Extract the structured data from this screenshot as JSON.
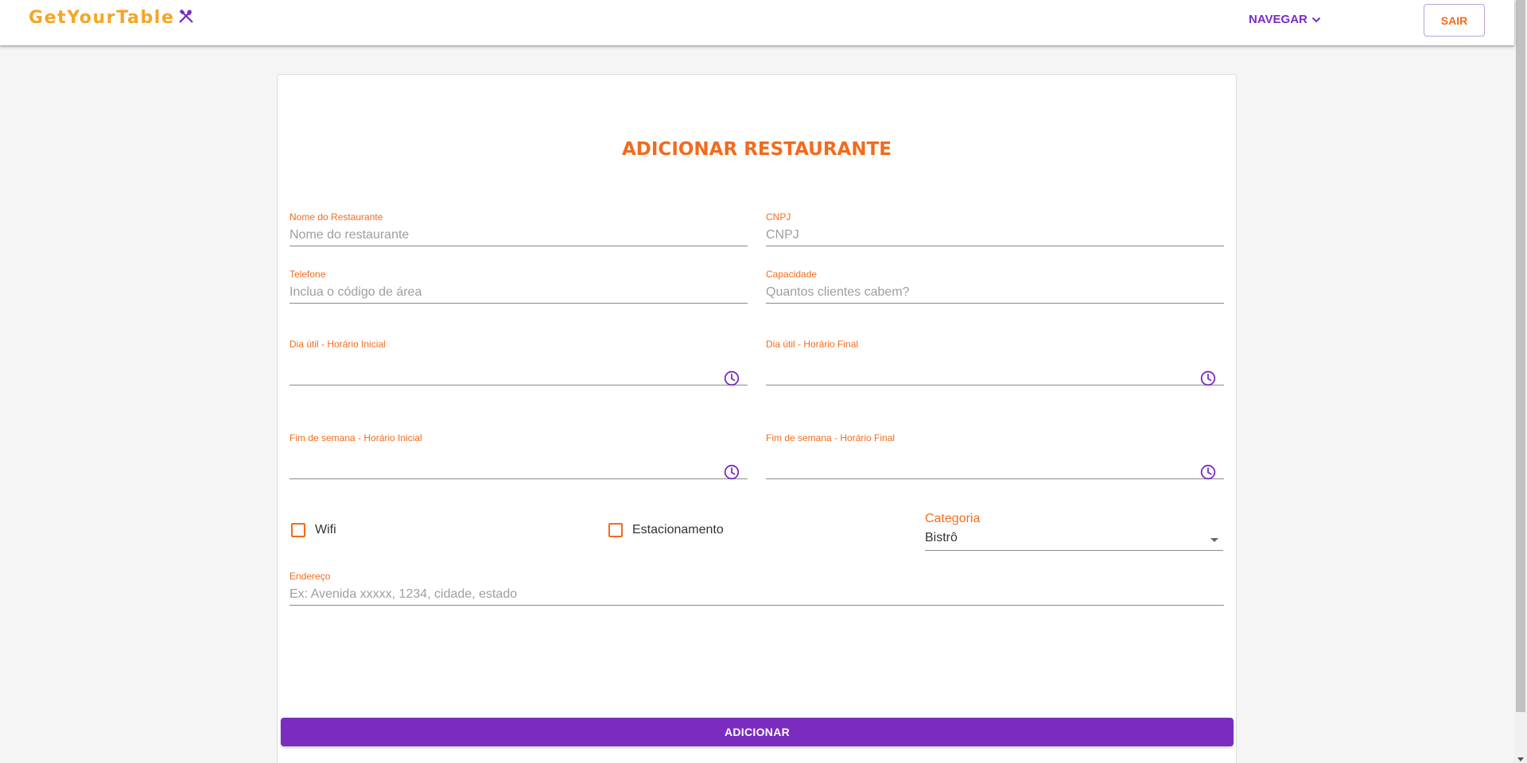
{
  "appbar": {
    "logo_text": "GetYourTable",
    "nav_label": "NAVEGAR",
    "logout_label": "SAIR"
  },
  "form": {
    "title": "ADICIONAR RESTAURANTE",
    "fields": {
      "restaurant_name": {
        "label": "Nome do Restaurante",
        "placeholder": "Nome do restaurante",
        "value": ""
      },
      "cnpj": {
        "label": "CNPJ",
        "placeholder": "CNPJ",
        "value": ""
      },
      "phone": {
        "label": "Telefone",
        "placeholder": "Inclua o código de área",
        "value": ""
      },
      "capacity": {
        "label": "Capacidade",
        "placeholder": "Quantos clientes cabem?",
        "value": ""
      },
      "weekday_start": {
        "label": "Dia útil - Horário Inicial",
        "value": ""
      },
      "weekday_end": {
        "label": "Dia útil - Horário Final",
        "value": ""
      },
      "weekend_start": {
        "label": "Fim de semana - Horário Inicial",
        "value": ""
      },
      "weekend_end": {
        "label": "Fim de semana - Horário Final",
        "value": ""
      },
      "address": {
        "label": "Endereço",
        "placeholder": "Ex: Avenida xxxxx, 1234, cidade, estado",
        "value": ""
      }
    },
    "checkboxes": {
      "wifi": {
        "label": "Wifi",
        "checked": false
      },
      "parking": {
        "label": "Estacionamento",
        "checked": false
      }
    },
    "category": {
      "label": "Categoria",
      "selected": "Bistrô"
    },
    "submit_label": "ADICIONAR"
  },
  "colors": {
    "primary": "#7b2cbf",
    "accent": "#f26b1d",
    "logo": "#f5a623",
    "background": "#f5f5f5"
  },
  "icons": {
    "logo": "utensils-icon",
    "nav": "chevron-down-icon",
    "time": "clock-icon",
    "select": "caret-down-icon"
  }
}
